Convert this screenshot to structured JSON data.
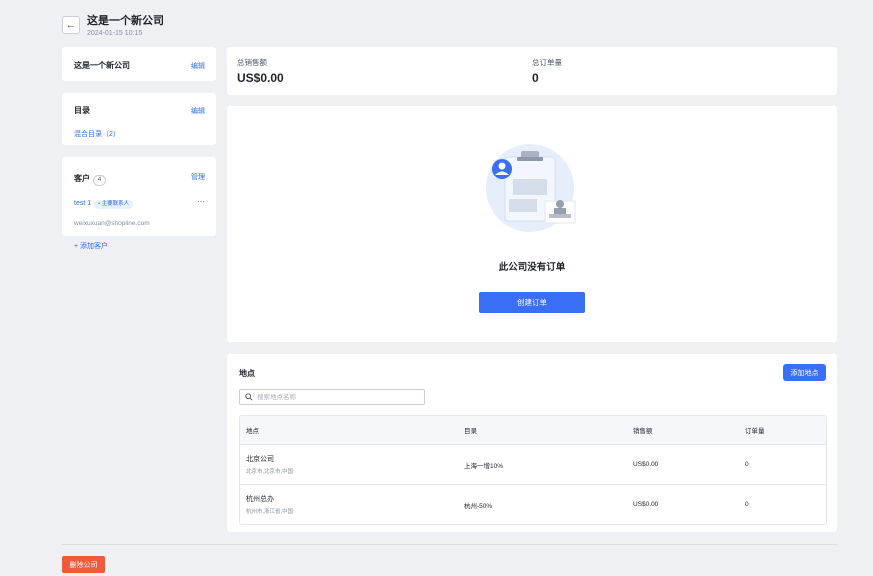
{
  "header": {
    "title": "这是一个新公司",
    "timestamp": "2024-01-15 10:15",
    "back_icon": "←"
  },
  "company_card": {
    "name": "这是一个新公司",
    "edit_label": "编辑"
  },
  "catalog_card": {
    "title": "目录",
    "edit_label": "编辑",
    "link_label": "混合目录（2）"
  },
  "customers_card": {
    "title": "客户",
    "count": "4",
    "manage_label": "管理",
    "customer_name": "test 1",
    "contact_tag": "• 主要联系人",
    "email": "weixuxuan@shopline.com",
    "more_icon": "···",
    "add_label": "+ 添加客户"
  },
  "stats": {
    "sales_label": "总销售额",
    "sales_value": "US$0.00",
    "orders_label": "总订单量",
    "orders_value": "0"
  },
  "empty_state": {
    "message": "此公司没有订单",
    "create_button": "创建订单"
  },
  "locations": {
    "title": "地点",
    "add_button": "添加地点",
    "search_placeholder": "搜索地点名称",
    "columns": [
      "地点",
      "目录",
      "销售额",
      "订单量"
    ],
    "rows": [
      {
        "name": "北京公司",
        "address": "北京市,北京市,中国",
        "catalog": "上海一增10%",
        "sales": "US$0.00",
        "orders": "0"
      },
      {
        "name": "杭州总办",
        "address": "杭州市,浙江省,中国",
        "catalog": "杭州-50%",
        "sales": "US$0.00",
        "orders": "0"
      }
    ]
  },
  "footer": {
    "delete_button": "删除公司"
  },
  "colors": {
    "primary": "#3a6ff5",
    "danger": "#f05a3c",
    "background": "#eef0f4"
  }
}
